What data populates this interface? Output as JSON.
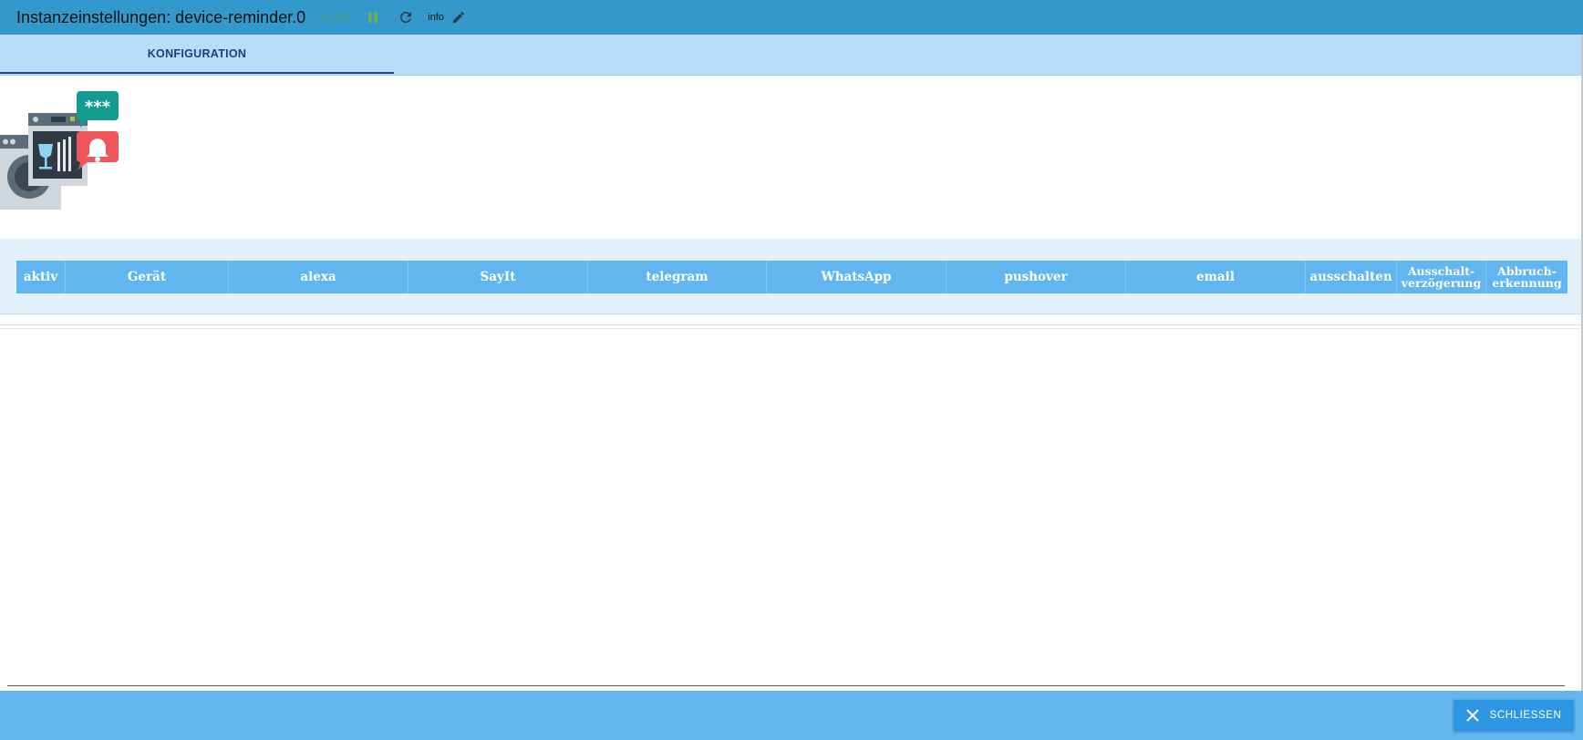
{
  "header": {
    "title": "Instanzeinstellungen: device-reminder.0",
    "version": "v1.2.8",
    "info_label": "info"
  },
  "tabs": [
    {
      "label": "KONFIGURATION"
    }
  ],
  "table": {
    "columns": [
      "aktiv",
      "Gerät",
      "alexa",
      "SayIt",
      "telegram",
      "WhatsApp",
      "pushover",
      "email",
      "ausschalten",
      "Ausschalt-verzögerung",
      "Abbruch-erkennung"
    ],
    "column_lines": {
      "ausschalt": [
        "Ausschalt-",
        "verzögerung"
      ],
      "abbruch": [
        "Abbruch-",
        "erkennung"
      ]
    }
  },
  "footer": {
    "close_label": "SCHLIESSEN"
  },
  "colors": {
    "titlebar": "#3399cc",
    "tabs_bg": "#b8ddf8",
    "header_cell": "#62b6f0",
    "footer": "#62b6f0",
    "close_button": "#2e97e5"
  },
  "icons": [
    "pause-icon",
    "refresh-icon",
    "pencil-icon",
    "close-icon",
    "device-reminder-logo"
  ]
}
